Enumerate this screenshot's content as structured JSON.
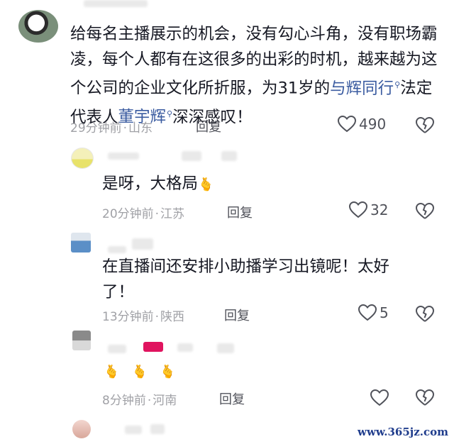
{
  "comments": [
    {
      "text_before": "给每名主播展示的机会，没有勾心斗角，没有职场霸凌，每个人都有在这很多的出彩的时机，越来越为这个公司的企业文化所折服，为31岁的",
      "link1": "与辉同行",
      "text_middle": "法定代表人",
      "link2": "董宇辉",
      "text_after": "深深感叹！",
      "time": "29分钟前",
      "location": "山东",
      "reply": "回复",
      "likes": "490"
    },
    {
      "text": "是呀，大格局",
      "time": "20分钟前",
      "location": "江苏",
      "reply": "回复",
      "likes": "32"
    },
    {
      "text_line1": "在直播间还安排小助播学习出镜呢！太好",
      "text_line2": "了！",
      "time": "13分钟前",
      "location": "陕西",
      "reply": "回复",
      "likes": "5"
    },
    {
      "time": "8分钟前",
      "location": "河南",
      "reply": "回复",
      "likes": ""
    }
  ],
  "separator": "·",
  "search_glyph": "ᕴ",
  "emoji": "🫰",
  "watermark": "www.365jz.com",
  "colors": {
    "link": "#3a5ba0",
    "meta": "#a0a1a6",
    "text": "#161823"
  },
  "icons": [
    "heart-icon",
    "broken-heart-icon",
    "finger-heart-emoji",
    "search-icon"
  ]
}
